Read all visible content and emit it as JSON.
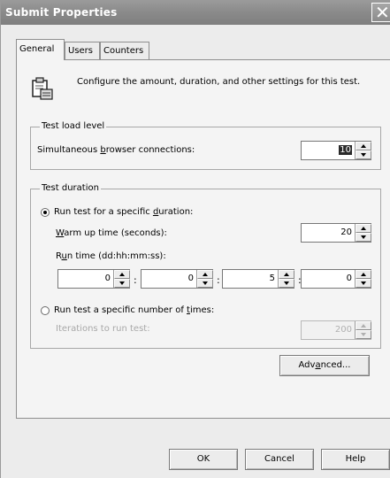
{
  "window": {
    "title": "Submit Properties",
    "close_glyph": "✕"
  },
  "tabs": [
    {
      "label": "General",
      "active": true
    },
    {
      "label": "Users",
      "active": false
    },
    {
      "label": "Counters",
      "active": false
    }
  ],
  "intro": {
    "icon": "properties-icon",
    "text": "Configure the amount, duration, and other settings for this test."
  },
  "load_level": {
    "group_label": "Test load level",
    "connections_label_pre": "Simultaneous ",
    "connections_label_key": "b",
    "connections_label_post": "rowser connections:",
    "connections_value": "10"
  },
  "duration": {
    "group_label": "Test duration",
    "specific_duration_pre": "Run test for a specific ",
    "specific_duration_key": "d",
    "specific_duration_post": "uration:",
    "specific_duration_selected": true,
    "warmup_key": "W",
    "warmup_post": "arm up time (seconds):",
    "warmup_value": "20",
    "runtime_pre": "R",
    "runtime_key": "u",
    "runtime_post": "n time (dd:hh:mm:ss):",
    "runtime_days": "0",
    "runtime_hours": "0",
    "runtime_minutes": "5",
    "runtime_seconds": "0",
    "colon": ":",
    "number_of_times_pre": "Run test a specific number of ",
    "number_of_times_key": "t",
    "number_of_times_post": "imes:",
    "number_of_times_selected": false,
    "iterations_label": "Iterations to run test:",
    "iterations_value": "200"
  },
  "buttons": {
    "advanced_pre": "Adv",
    "advanced_key": "a",
    "advanced_post": "nced...",
    "ok": "OK",
    "cancel": "Cancel",
    "help": "Help"
  }
}
